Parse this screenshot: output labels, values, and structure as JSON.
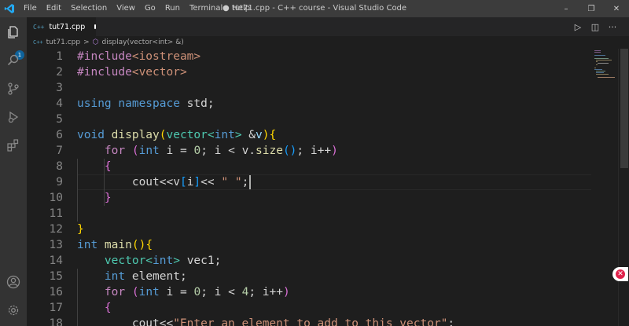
{
  "window": {
    "title": "● tut71.cpp - C++ course - Visual Studio Code",
    "controls": {
      "minimize": "–",
      "restore": "❐",
      "close": "✕"
    }
  },
  "menu": [
    "File",
    "Edit",
    "Selection",
    "View",
    "Go",
    "Run",
    "Terminal",
    "Help"
  ],
  "activity_bar": {
    "icons": [
      "files-icon",
      "search-icon",
      "source-control-icon",
      "run-debug-icon",
      "extensions-icon",
      "account-icon",
      "settings-gear-icon"
    ],
    "explorer_badge": "1"
  },
  "tab": {
    "icon_text": "C++",
    "label": "tut71.cpp"
  },
  "editor_actions": {
    "run": "▷",
    "split": "◫",
    "more": "···"
  },
  "breadcrumbs": {
    "icon_text": "C++",
    "file": "tut71.cpp",
    "separator": ">",
    "symbol_icon": "⬡",
    "symbol": "display(vector<int> &)"
  },
  "code_lines": [
    {
      "n": "1",
      "t": [
        [
          "#include",
          "#c586c0"
        ],
        [
          "<iostream>",
          "#ce9178"
        ]
      ]
    },
    {
      "n": "2",
      "t": [
        [
          "#include",
          "#c586c0"
        ],
        [
          "<vector>",
          "#ce9178"
        ]
      ]
    },
    {
      "n": "3",
      "t": []
    },
    {
      "n": "4",
      "t": [
        [
          "using namespace",
          "#569cd6"
        ],
        [
          " std;",
          "#d4d4d4"
        ]
      ]
    },
    {
      "n": "5",
      "t": []
    },
    {
      "n": "6",
      "t": [
        [
          "void",
          "#569cd6"
        ],
        [
          " display",
          "#dcdcaa"
        ],
        [
          "(",
          "#ffd700"
        ],
        [
          "vector<",
          "#4ec9b0"
        ],
        [
          "int",
          "#569cd6"
        ],
        [
          "> ",
          "#4ec9b0"
        ],
        [
          "&",
          "#d4d4d4"
        ],
        [
          "v",
          "#9cdcfe"
        ],
        [
          ")",
          "#ffd700"
        ],
        [
          "{",
          "#ffd700"
        ]
      ]
    },
    {
      "n": "7",
      "t": [
        [
          "    ",
          "#d4d4d4"
        ],
        [
          "for",
          "#c586c0"
        ],
        [
          " ",
          "#d4d4d4"
        ],
        [
          "(",
          "#da70d6"
        ],
        [
          "int",
          "#569cd6"
        ],
        [
          " i = ",
          "#d4d4d4"
        ],
        [
          "0",
          "#b5cea8"
        ],
        [
          "; i < v.",
          "#d4d4d4"
        ],
        [
          "size",
          "#dcdcaa"
        ],
        [
          "()",
          "#179fff"
        ],
        [
          "; i++",
          "#d4d4d4"
        ],
        [
          ")",
          "#da70d6"
        ]
      ]
    },
    {
      "n": "8",
      "t": [
        [
          "    ",
          "#d4d4d4"
        ],
        [
          "{",
          "#da70d6"
        ]
      ]
    },
    {
      "n": "9",
      "t": [
        [
          "        cout<<v",
          "#d4d4d4"
        ],
        [
          "[",
          "#179fff"
        ],
        [
          "i",
          "#d4d4d4"
        ],
        [
          "]",
          "#179fff"
        ],
        [
          "<< ",
          "#d4d4d4"
        ],
        [
          "\" \"",
          "#ce9178"
        ],
        [
          ";",
          "#d4d4d4"
        ]
      ]
    },
    {
      "n": "10",
      "t": [
        [
          "    ",
          "#d4d4d4"
        ],
        [
          "}",
          "#da70d6"
        ]
      ]
    },
    {
      "n": "11",
      "t": []
    },
    {
      "n": "12",
      "t": [
        [
          "}",
          "#ffd700"
        ]
      ]
    },
    {
      "n": "13",
      "t": [
        [
          "int",
          "#569cd6"
        ],
        [
          " main",
          "#dcdcaa"
        ],
        [
          "()",
          "#ffd700"
        ],
        [
          "{",
          "#ffd700"
        ]
      ]
    },
    {
      "n": "14",
      "t": [
        [
          "    ",
          "#d4d4d4"
        ],
        [
          "vector<",
          "#4ec9b0"
        ],
        [
          "int",
          "#569cd6"
        ],
        [
          "> ",
          "#4ec9b0"
        ],
        [
          "vec1;",
          "#d4d4d4"
        ]
      ]
    },
    {
      "n": "15",
      "t": [
        [
          "    ",
          "#d4d4d4"
        ],
        [
          "int",
          "#569cd6"
        ],
        [
          " element;",
          "#d4d4d4"
        ]
      ]
    },
    {
      "n": "16",
      "t": [
        [
          "    ",
          "#d4d4d4"
        ],
        [
          "for",
          "#c586c0"
        ],
        [
          " ",
          "#d4d4d4"
        ],
        [
          "(",
          "#da70d6"
        ],
        [
          "int",
          "#569cd6"
        ],
        [
          " i = ",
          "#d4d4d4"
        ],
        [
          "0",
          "#b5cea8"
        ],
        [
          "; i < ",
          "#d4d4d4"
        ],
        [
          "4",
          "#b5cea8"
        ],
        [
          "; i++",
          "#d4d4d4"
        ],
        [
          ")",
          "#da70d6"
        ]
      ]
    },
    {
      "n": "17",
      "t": [
        [
          "    ",
          "#d4d4d4"
        ],
        [
          "{",
          "#da70d6"
        ]
      ]
    },
    {
      "n": "18",
      "t": [
        [
          "        cout<<",
          "#d4d4d4"
        ],
        [
          "\"Enter an element to add to this vector\"",
          "#ce9178"
        ],
        [
          ";",
          "#d4d4d4"
        ]
      ]
    }
  ],
  "colors": {
    "accent": "#0e639c",
    "background": "#1e1e1e",
    "titlebar": "#3c3c3c",
    "activitybar": "#333333"
  }
}
